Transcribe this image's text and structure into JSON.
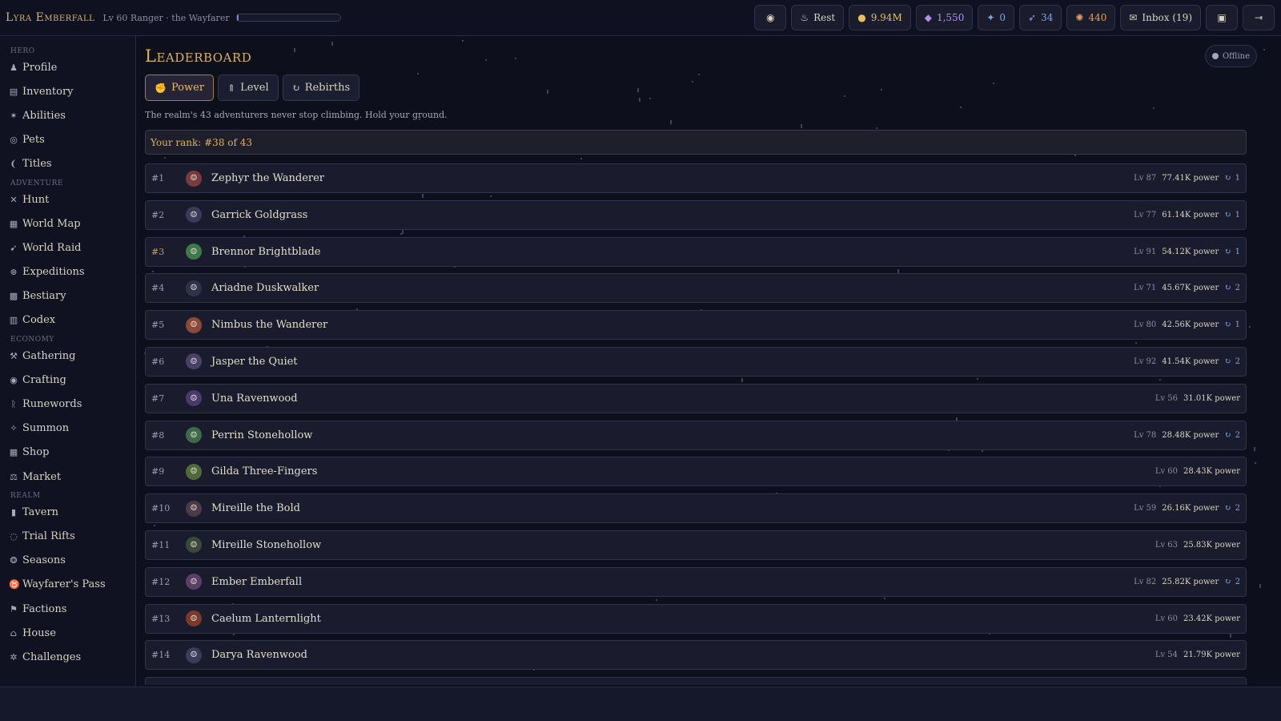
{
  "header": {
    "hero_name": "Lyra Emberfall",
    "hero_subtitle": "Lv 60 Ranger · the Wayfarer",
    "xp_fraction": 0.02,
    "buttons": [
      {
        "name": "spellbook-button",
        "icon": "orb-icon",
        "glyph": "◉",
        "label": "",
        "tone": ""
      },
      {
        "name": "rest-button",
        "icon": "campfire-icon",
        "glyph": "♨",
        "label": "Rest",
        "tone": ""
      },
      {
        "name": "gold-counter",
        "icon": "coin-icon",
        "glyph": "●",
        "label": "9.94M",
        "tone": "gold"
      },
      {
        "name": "gem-counter",
        "icon": "gem-icon",
        "glyph": "◆",
        "label": "1,550",
        "tone": "gem"
      },
      {
        "name": "essence-counter",
        "icon": "essence-icon",
        "glyph": "✦",
        "label": "0",
        "tone": "blue"
      },
      {
        "name": "feather-counter",
        "icon": "feather-icon",
        "glyph": "➶",
        "label": "34",
        "tone": "blue"
      },
      {
        "name": "spark-counter",
        "icon": "spark-icon",
        "glyph": "✺",
        "label": "440",
        "tone": "orange"
      },
      {
        "name": "inbox-button",
        "icon": "envelope-icon",
        "glyph": "✉",
        "label": "Inbox (19)",
        "tone": ""
      },
      {
        "name": "save-button",
        "icon": "disk-icon",
        "glyph": "▣",
        "label": "",
        "tone": ""
      },
      {
        "name": "logout-button",
        "icon": "door-icon",
        "glyph": "⇥",
        "label": "",
        "tone": ""
      }
    ]
  },
  "sidebar": {
    "sections": [
      {
        "title": "Hero",
        "items": [
          {
            "label": "Profile",
            "icon": "person-icon",
            "glyph": "♟"
          },
          {
            "label": "Inventory",
            "icon": "backpack-icon",
            "glyph": "▤"
          },
          {
            "label": "Abilities",
            "icon": "runner-icon",
            "glyph": "✶"
          },
          {
            "label": "Pets",
            "icon": "paw-icon",
            "glyph": "◎"
          },
          {
            "label": "Titles",
            "icon": "laurel-icon",
            "glyph": "❨"
          }
        ]
      },
      {
        "title": "Adventure",
        "items": [
          {
            "label": "Hunt",
            "icon": "crossed-swords-icon",
            "glyph": "✕"
          },
          {
            "label": "World Map",
            "icon": "map-icon",
            "glyph": "▦"
          },
          {
            "label": "World Raid",
            "icon": "dragon-icon",
            "glyph": "➹"
          },
          {
            "label": "Expeditions",
            "icon": "compass-icon",
            "glyph": "⊛"
          },
          {
            "label": "Bestiary",
            "icon": "beast-icon",
            "glyph": "▩"
          },
          {
            "label": "Codex",
            "icon": "book-icon",
            "glyph": "▥"
          }
        ]
      },
      {
        "title": "Economy",
        "items": [
          {
            "label": "Gathering",
            "icon": "pickaxe-icon",
            "glyph": "⚒"
          },
          {
            "label": "Crafting",
            "icon": "anvil-icon",
            "glyph": "◉"
          },
          {
            "label": "Runewords",
            "icon": "rune-icon",
            "glyph": "ᚱ"
          },
          {
            "label": "Summon",
            "icon": "summon-icon",
            "glyph": "✧"
          },
          {
            "label": "Shop",
            "icon": "shop-icon",
            "glyph": "▦"
          },
          {
            "label": "Market",
            "icon": "scales-icon",
            "glyph": "⚖"
          }
        ]
      },
      {
        "title": "Realm",
        "items": [
          {
            "label": "Tavern",
            "icon": "tankard-icon",
            "glyph": "▮"
          },
          {
            "label": "Trial Rifts",
            "icon": "portal-icon",
            "glyph": "◌"
          },
          {
            "label": "Seasons",
            "icon": "season-icon",
            "glyph": "❂"
          },
          {
            "label": "Wayfarer's Pass",
            "icon": "medal-icon",
            "glyph": "♉"
          },
          {
            "label": "Factions",
            "icon": "banner-icon",
            "glyph": "⚑"
          },
          {
            "label": "House",
            "icon": "house-icon",
            "glyph": "⌂"
          },
          {
            "label": "Challenges",
            "icon": "challenge-icon",
            "glyph": "✲"
          }
        ]
      }
    ]
  },
  "main": {
    "title": "Leaderboard",
    "status": "Offline",
    "tabs": [
      {
        "label": "Power",
        "icon": "fist-icon",
        "glyph": "✊",
        "active": true
      },
      {
        "label": "Level",
        "icon": "wings-icon",
        "glyph": "⇑",
        "active": false
      },
      {
        "label": "Rebirths",
        "icon": "cycle-icon",
        "glyph": "↻",
        "active": false
      }
    ],
    "subtitle": "The realm's 43 adventurers never stop climbing. Hold your ground.",
    "your_rank": "Your rank: #38 of 43",
    "rows": [
      {
        "rank": "#1",
        "name": "Zephyr the Wanderer",
        "level": "Lv 87",
        "power": "77.41K power",
        "rebirths": "1",
        "avatar": "#7a3b3f"
      },
      {
        "rank": "#2",
        "name": "Garrick Goldgrass",
        "level": "Lv 77",
        "power": "61.14K power",
        "rebirths": "1",
        "avatar": "#3b3a5a"
      },
      {
        "rank": "#3",
        "name": "Brennor Brightblade",
        "level": "Lv 91",
        "power": "54.12K power",
        "rebirths": "1",
        "avatar": "#3e7a48"
      },
      {
        "rank": "#4",
        "name": "Ariadne Duskwalker",
        "level": "Lv 71",
        "power": "45.67K power",
        "rebirths": "2",
        "avatar": "#30324a"
      },
      {
        "rank": "#5",
        "name": "Nimbus the Wanderer",
        "level": "Lv 80",
        "power": "42.56K power",
        "rebirths": "1",
        "avatar": "#8a4a3a"
      },
      {
        "rank": "#6",
        "name": "Jasper the Quiet",
        "level": "Lv 92",
        "power": "41.54K power",
        "rebirths": "2",
        "avatar": "#4a3f66"
      },
      {
        "rank": "#7",
        "name": "Una Ravenwood",
        "level": "Lv 56",
        "power": "31.01K power",
        "rebirths": "",
        "avatar": "#4a3a6a"
      },
      {
        "rank": "#8",
        "name": "Perrin Stonehollow",
        "level": "Lv 78",
        "power": "28.48K power",
        "rebirths": "2",
        "avatar": "#3f6a4a"
      },
      {
        "rank": "#9",
        "name": "Gilda Three-Fingers",
        "level": "Lv 60",
        "power": "28.43K power",
        "rebirths": "",
        "avatar": "#4d6a3a"
      },
      {
        "rank": "#10",
        "name": "Mireille the Bold",
        "level": "Lv 59",
        "power": "26.16K power",
        "rebirths": "2",
        "avatar": "#4a3a4a"
      },
      {
        "rank": "#11",
        "name": "Mireille Stonehollow",
        "level": "Lv 63",
        "power": "25.83K power",
        "rebirths": "",
        "avatar": "#3a4a3a"
      },
      {
        "rank": "#12",
        "name": "Ember Emberfall",
        "level": "Lv 82",
        "power": "25.82K power",
        "rebirths": "2",
        "avatar": "#5a3f6a"
      },
      {
        "rank": "#13",
        "name": "Caelum Lanternlight",
        "level": "Lv 60",
        "power": "23.42K power",
        "rebirths": "",
        "avatar": "#7a3a2a"
      },
      {
        "rank": "#14",
        "name": "Darya Ravenwood",
        "level": "Lv 54",
        "power": "21.79K power",
        "rebirths": "",
        "avatar": "#3a3d5a"
      }
    ]
  }
}
